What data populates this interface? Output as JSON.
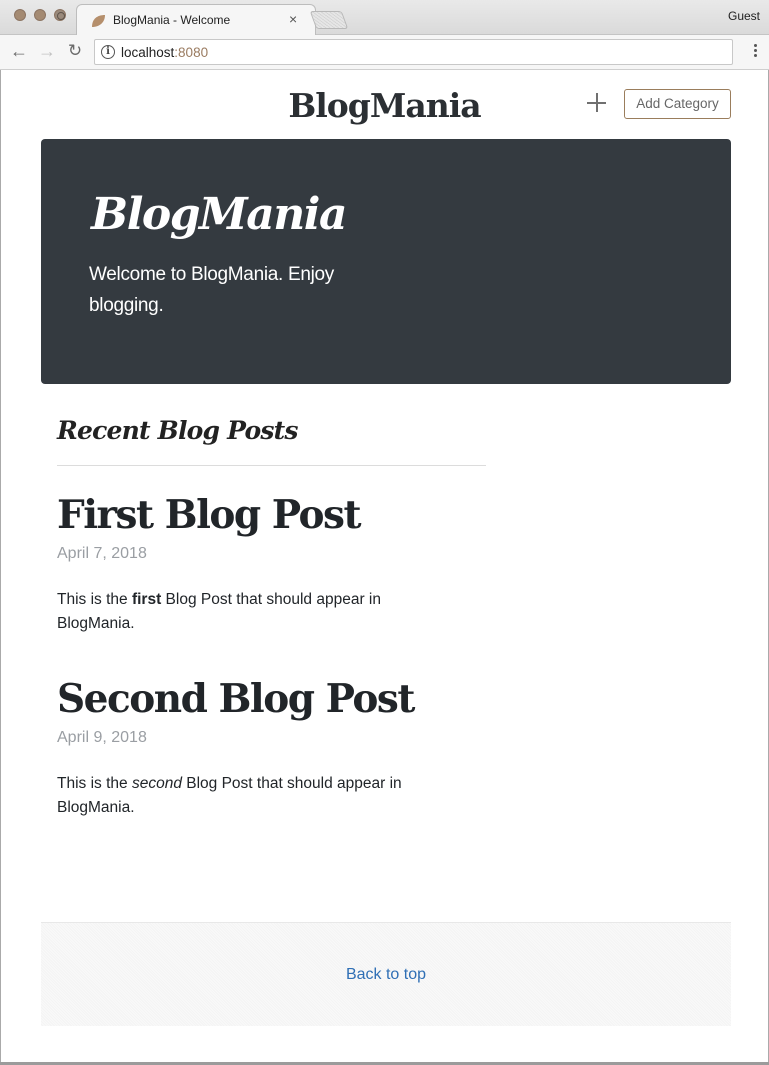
{
  "browser": {
    "tab_title": "BlogMania - Welcome",
    "tab_close": "×",
    "profile": "Guest",
    "url_host": "localhost",
    "url_port": ":8080",
    "nav": {
      "back": "←",
      "forward": "→",
      "reload": "↻"
    },
    "info_glyph": "i"
  },
  "header": {
    "brand": "BlogMania",
    "add_category_label": "Add Category"
  },
  "jumbotron": {
    "title": "BlogMania",
    "lead": "Welcome to BlogMania. Enjoy blogging."
  },
  "recent": {
    "heading": "Recent Blog Posts",
    "posts": [
      {
        "title": "First Blog Post",
        "date": "April 7, 2018",
        "body_before": "This is the ",
        "body_emph": "first",
        "body_after": " Blog Post that should appear in BlogMania."
      },
      {
        "title": "Second Blog Post",
        "date": "April 9, 2018",
        "body_before": "This is the ",
        "body_emph": "second",
        "body_after": " Blog Post that should appear in BlogMania."
      }
    ]
  },
  "footer": {
    "back_to_top": "Back to top"
  },
  "colors": {
    "jumbotron_bg": "#343a40",
    "link": "#2f6fb5",
    "date": "#9a9ea3"
  }
}
